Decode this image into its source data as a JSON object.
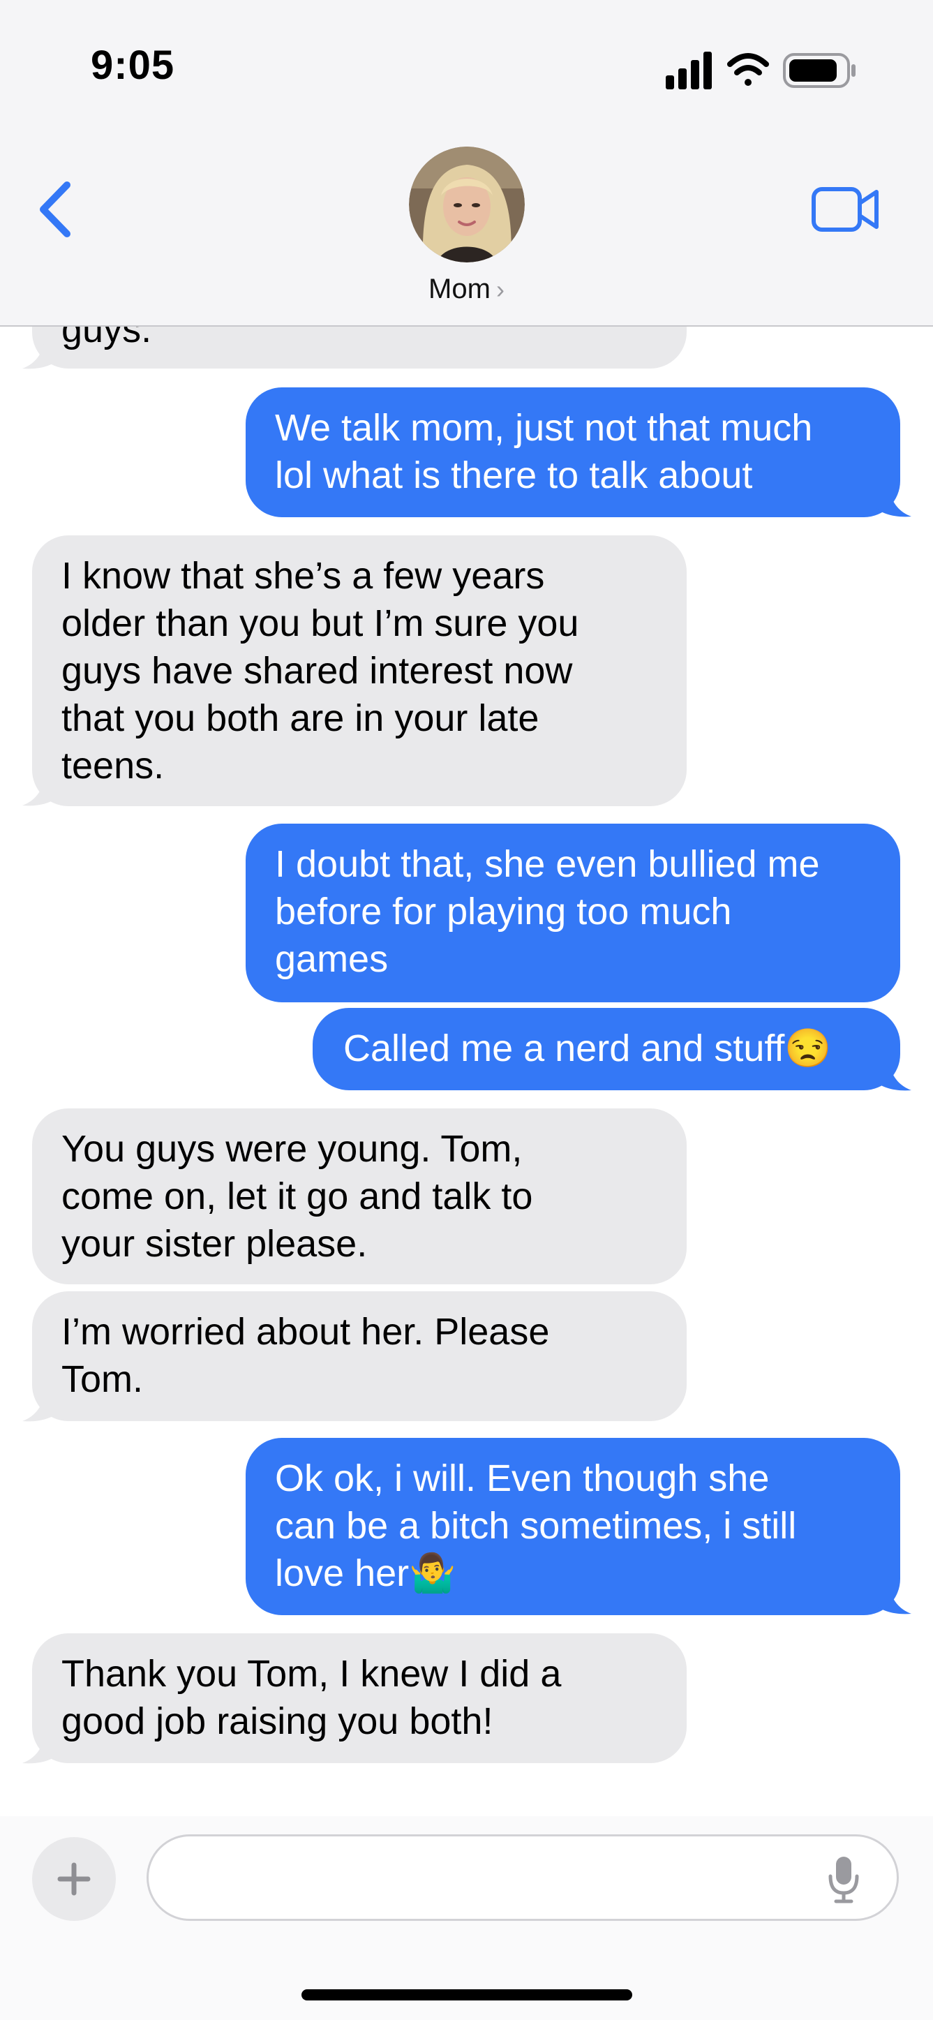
{
  "status_bar": {
    "time": "9:05",
    "icons": [
      "cellular-signal-icon",
      "wifi-icon",
      "battery-icon"
    ]
  },
  "header": {
    "contact_name": "Mom",
    "chevron": "›",
    "icons": [
      "back-chevron-icon",
      "contact-avatar",
      "video-camera-icon"
    ]
  },
  "colors": {
    "outgoing": "#3478f6",
    "incoming": "#e9e9eb",
    "accent": "#3478f6"
  },
  "messages": [
    {
      "direction": "in",
      "text": "guys."
    },
    {
      "direction": "out",
      "text": "We talk mom, just not that much\nlol what is there to talk about"
    },
    {
      "direction": "in",
      "text": "I know that she’s a few years\nolder than you but I’m sure you\nguys have shared interest now\nthat you both are in your late\nteens."
    },
    {
      "direction": "out",
      "text": "I doubt that, she even bullied me\nbefore for playing too much\ngames"
    },
    {
      "direction": "out",
      "text": "Called me a nerd and stuff😒"
    },
    {
      "direction": "in",
      "text": "You guys were young. Tom,\ncome on, let it go and talk to\nyour sister please."
    },
    {
      "direction": "in",
      "text": "I’m worried about her. Please\nTom."
    },
    {
      "direction": "out",
      "text": "Ok ok, i will. Even though she\ncan be a bitch sometimes, i still\nlove her🤷‍♂️"
    },
    {
      "direction": "in",
      "text": "Thank you Tom, I knew I did a\ngood job raising you both!"
    }
  ],
  "input_bar": {
    "plus_label": "+",
    "placeholder": "",
    "value": "",
    "icons": [
      "plus-icon",
      "microphone-icon"
    ]
  }
}
